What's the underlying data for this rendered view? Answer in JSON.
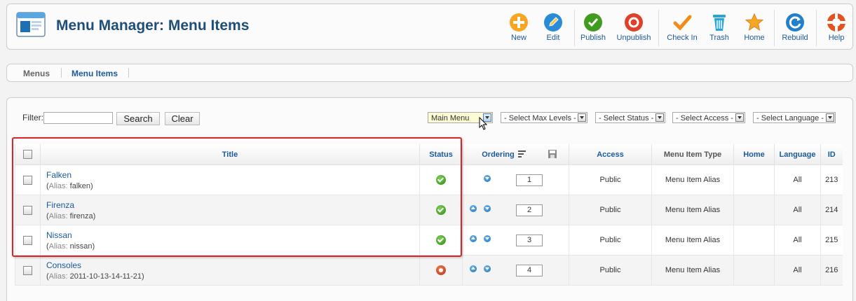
{
  "header": {
    "title": "Menu Manager: Menu Items"
  },
  "toolbar": [
    {
      "label": "New",
      "icon": "new-icon",
      "color": "#f6a623"
    },
    {
      "label": "Edit",
      "icon": "edit-icon",
      "color": "#2a8bd6"
    },
    {
      "label": "Publish",
      "icon": "publish-icon",
      "color": "#3f9c1f"
    },
    {
      "label": "Unpublish",
      "icon": "unpublish-icon",
      "color": "#e0402a"
    },
    {
      "label": "Check In",
      "icon": "check-in-icon",
      "color": "#f08c17"
    },
    {
      "label": "Trash",
      "icon": "trash-icon",
      "color": "#29a3d9"
    },
    {
      "label": "Home",
      "icon": "home-star-icon",
      "color": "#f5a623"
    },
    {
      "label": "Rebuild",
      "icon": "rebuild-icon",
      "color": "#2180c9"
    },
    {
      "label": "Help",
      "icon": "help-lifebuoy-icon",
      "color": "#e5521f"
    }
  ],
  "submenu": {
    "menus": "Menus",
    "menu_items": "Menu Items"
  },
  "filter": {
    "label": "Filter:",
    "value": "",
    "search_button": "Search",
    "clear_button": "Clear",
    "menu_select": "Main Menu",
    "levels_select": "- Select Max Levels -",
    "status_select": "- Select Status -",
    "access_select": "- Select Access -",
    "language_select": "- Select Language -"
  },
  "table": {
    "headers": {
      "title": "Title",
      "status": "Status",
      "ordering": "Ordering",
      "access": "Access",
      "type": "Menu Item Type",
      "home": "Home",
      "language": "Language",
      "id": "ID"
    },
    "rows": [
      {
        "title": "Falken",
        "alias_key": "Alias:",
        "alias": "falken",
        "status": "published",
        "order": "1",
        "access": "Public",
        "type": "Menu Item Alias",
        "home": "",
        "language": "All",
        "id": "213",
        "up": false,
        "down": true
      },
      {
        "title": "Firenza",
        "alias_key": "Alias:",
        "alias": "firenza",
        "status": "published",
        "order": "2",
        "access": "Public",
        "type": "Menu Item Alias",
        "home": "",
        "language": "All",
        "id": "214",
        "up": true,
        "down": true
      },
      {
        "title": "Nissan",
        "alias_key": "Alias:",
        "alias": "nissan",
        "status": "published",
        "order": "3",
        "access": "Public",
        "type": "Menu Item Alias",
        "home": "",
        "language": "All",
        "id": "215",
        "up": true,
        "down": true
      },
      {
        "title": "Consoles",
        "alias_key": "Alias:",
        "alias": "2011-10-13-14-11-21",
        "status": "unpublished",
        "order": "4",
        "access": "Public",
        "type": "Menu Item Alias",
        "home": "",
        "language": "All",
        "id": "216",
        "up": true,
        "down": true
      }
    ]
  },
  "colors": {
    "title_blue": "#1f4e79",
    "link_blue": "#1a5a9a",
    "highlight_red": "#d4262b"
  }
}
